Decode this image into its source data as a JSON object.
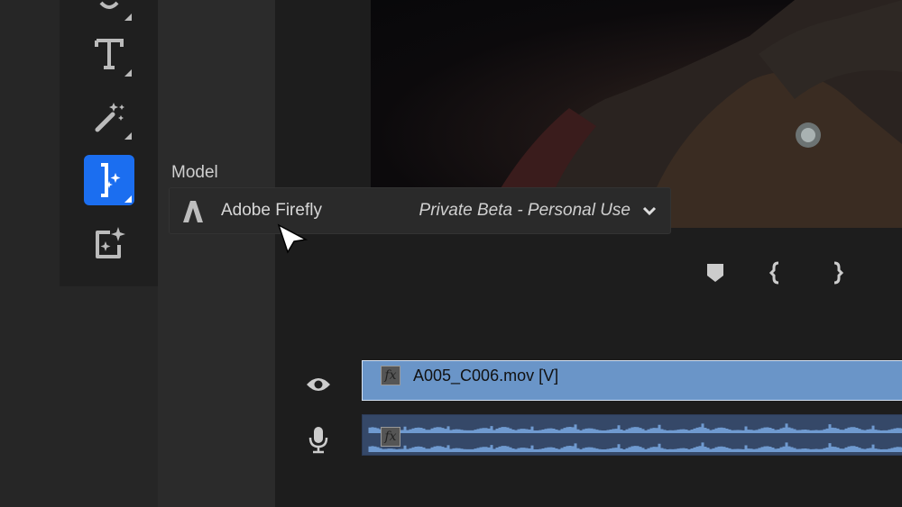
{
  "model": {
    "label": "Model",
    "selected": "Adobe Firefly",
    "selected_detail": "Private Beta - Personal Use",
    "icon": "adobe-firefly-logo"
  },
  "toolbar": {
    "tools": [
      {
        "name": "partial-tool-icon"
      },
      {
        "name": "type-tool-icon"
      },
      {
        "name": "magic-wand-icon"
      },
      {
        "name": "generative-extend-icon",
        "active": true
      },
      {
        "name": "generative-image-icon"
      }
    ],
    "accent": "#1b6ef0"
  },
  "timeline": {
    "markers": [
      "marker-icon",
      "mark-in-icon",
      "mark-out-icon"
    ],
    "video_clip": {
      "name": "A005_C006.mov [V]",
      "fx": "fx",
      "color": "#6a95c8"
    },
    "audio_clip": {
      "fx": "fx",
      "color": "#354868"
    }
  }
}
